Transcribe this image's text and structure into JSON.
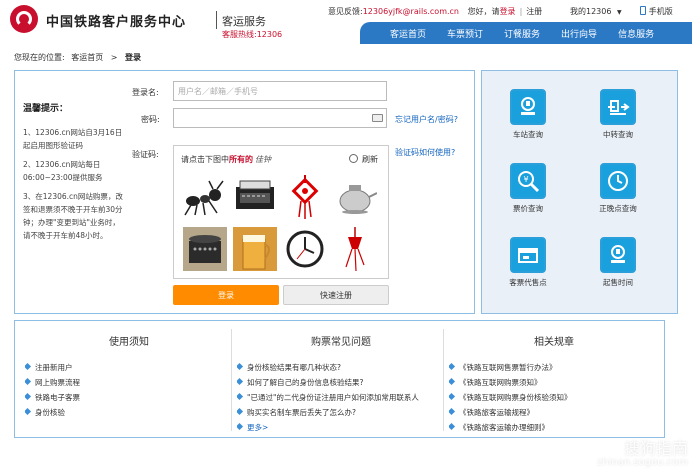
{
  "header": {
    "brand": "中国铁路客户服务中心",
    "service": "客运服务",
    "hotline": "客服热线:12306",
    "feedback_label": "意见反馈:",
    "feedback_email": "12306yjfk@rails.com.cn",
    "greeting": "您好，请",
    "login_link": "登录",
    "register_link": "注册",
    "my12306": "我的12306",
    "mobile": "手机版"
  },
  "nav": {
    "items": [
      "客运首页",
      "车票预订",
      "订餐服务",
      "出行向导",
      "信息服务"
    ]
  },
  "breadcrumb": {
    "label": "您现在的位置:",
    "home": "客运首页",
    "sep": ">",
    "current": "登录"
  },
  "tips": {
    "title": "温馨提示：",
    "items": [
      "1、12306.cn网站自3月16日起启用图形验证码",
      "2、12306.cn网站每日06:00~23:00提供服务",
      "3、在12306.cn网站购票，改签和退票须不晚于开车前30分钟；办理\"变更到站\"业务时，请不晚于开车前48小时。"
    ]
  },
  "login": {
    "username_label": "登录名:",
    "username_placeholder": "用户名／邮箱／手机号",
    "password_label": "密码:",
    "forgot_link": "忘记用户名/密码?",
    "captcha_label": "验证码:",
    "captcha_help": "验证码如何使用?",
    "captcha_prompt_a": "请点击下图中",
    "captcha_prompt_b": "所有的",
    "captcha_word": "佳钟",
    "refresh": "刷新",
    "login_button": "登录",
    "register_button": "快速注册"
  },
  "services": [
    {
      "label": "车站查询",
      "icon": "station-icon"
    },
    {
      "label": "中转查询",
      "icon": "transfer-icon"
    },
    {
      "label": "票价查询",
      "icon": "fare-icon"
    },
    {
      "label": "正晚点查询",
      "icon": "clock-icon"
    },
    {
      "label": "客票代售点",
      "icon": "ticket-agency-icon"
    },
    {
      "label": "起售时间",
      "icon": "sale-time-icon"
    }
  ],
  "bottom": {
    "col1": {
      "title": "使用须知",
      "items": [
        "注册新用户",
        "网上购票流程",
        "铁路电子客票",
        "身份核验"
      ]
    },
    "col2": {
      "title": "购票常见问题",
      "items": [
        "身份核验结果有哪几种状态?",
        "如何了解自己的身份信息核验结果?",
        "\"已通过\"的二代身份证注册用户如何添加常用联系人",
        "购买实名制车票后丢失了怎么办?"
      ],
      "more": "更多>"
    },
    "col3": {
      "title": "相关规章",
      "items": [
        "《铁路互联网售票暂行办法》",
        "《铁路互联网购票须知》",
        "《铁路互联网购票身份核验须知》",
        "《铁路旅客运输规程》",
        "《铁路旅客运输办理细则》"
      ]
    }
  },
  "watermark": {
    "text": "搜狗指南",
    "domain": "zhinan.sogou.com"
  },
  "colors": {
    "brand_red": "#c8102e",
    "nav_blue": "#2b78c5",
    "accent_orange": "#ff8c00",
    "link_blue": "#1565c0"
  }
}
